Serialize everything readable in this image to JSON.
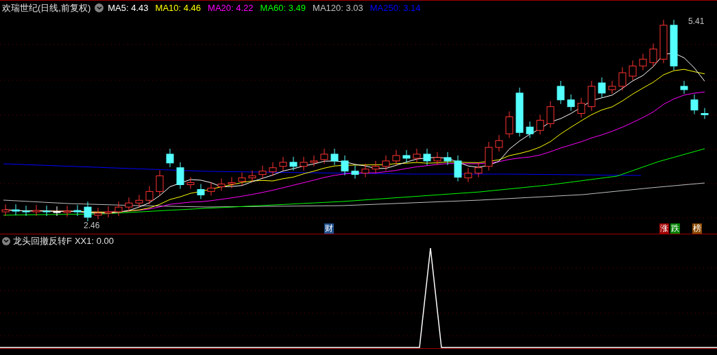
{
  "header": {
    "title": "欢瑞世纪(日线,前复权)",
    "indicators": [
      {
        "label": "MA5: 4.43",
        "color": "#ffffff"
      },
      {
        "label": "MA10: 4.46",
        "color": "#ffff00"
      },
      {
        "label": "MA20: 4.22",
        "color": "#ff00ff"
      },
      {
        "label": "MA60: 3.49",
        "color": "#00ff00"
      },
      {
        "label": "MA120: 3.03",
        "color": "#c0c0c0"
      },
      {
        "label": "MA250: 3.14",
        "color": "#0000ff"
      }
    ]
  },
  "price_labels": {
    "high": "5.41",
    "low": "2.46"
  },
  "markers": [
    {
      "text": "财",
      "color": "#1e4f8c"
    },
    {
      "text": "涨",
      "color": "#a00000"
    },
    {
      "text": "跌",
      "color": "#008000"
    },
    {
      "text": "榜",
      "color": "#8a4a00"
    }
  ],
  "subpanel": {
    "title": "龙头回撤反转F",
    "reading": "XX1: 0.00"
  }
}
